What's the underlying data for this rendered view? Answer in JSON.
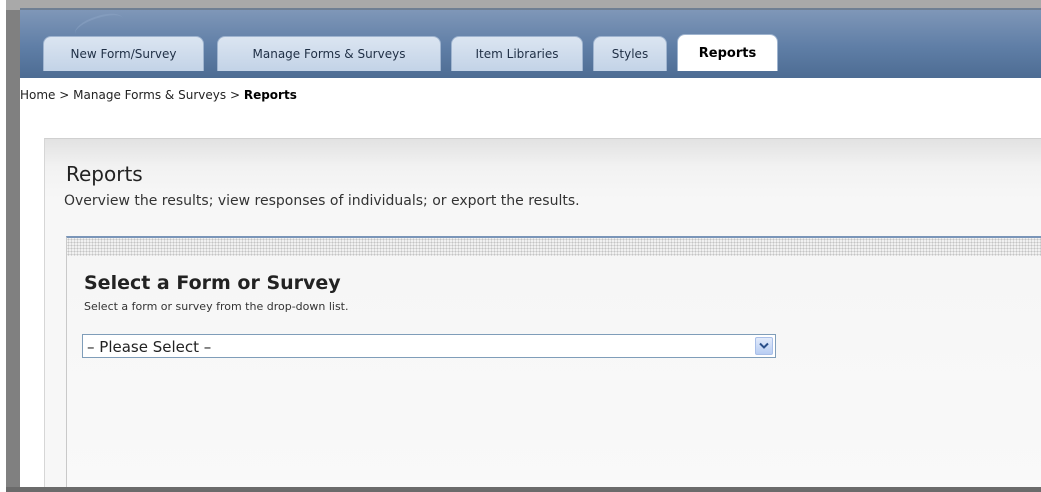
{
  "tabs": [
    {
      "label": "New Form/Survey"
    },
    {
      "label": "Manage Forms & Surveys"
    },
    {
      "label": "Item Libraries"
    },
    {
      "label": "Styles"
    },
    {
      "label": "Reports"
    }
  ],
  "breadcrumb": {
    "home": "Home",
    "separator": ">",
    "manage": "Manage Forms & Surveys",
    "current": "Reports"
  },
  "page": {
    "title": "Reports",
    "description": "Overview the results; view responses of individuals; or export the results."
  },
  "section": {
    "title": "Select a Form or Survey",
    "description": "Select a form or survey from the drop-down list.",
    "select_value": "– Please Select –"
  },
  "colors": {
    "tab_bar": "#5f7ea6",
    "divider": "#7a95b8",
    "panel": "#f2f2f2"
  },
  "icons": {
    "dropdown": "chevron-down-icon"
  }
}
